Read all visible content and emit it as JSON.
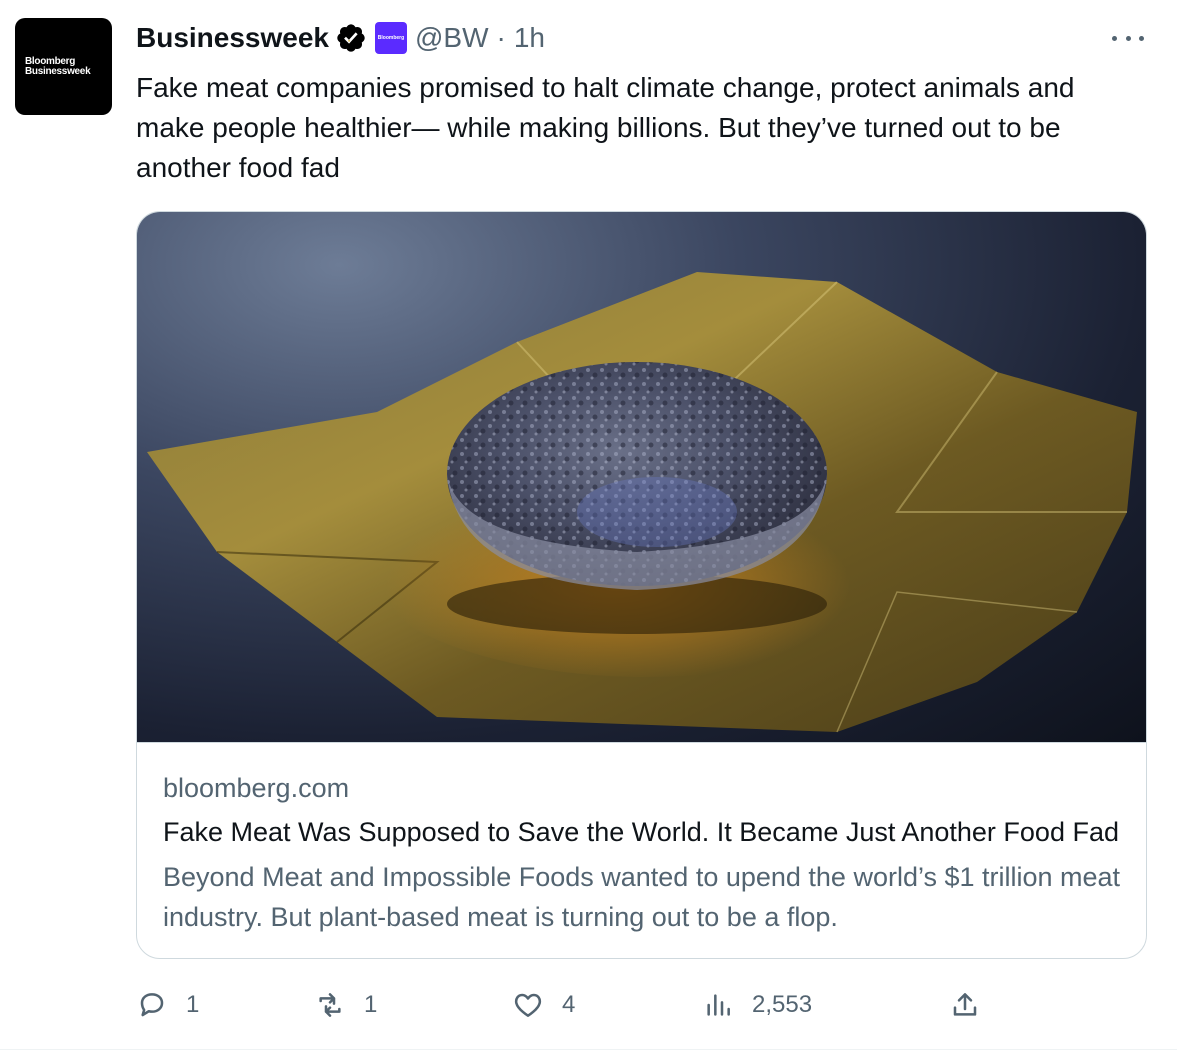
{
  "account": {
    "avatar_line1": "Bloomberg",
    "avatar_line2": "Businessweek",
    "display_name": "Businessweek",
    "affiliate_badge_text": "Bloomberg",
    "handle": "@BW",
    "separator": "·",
    "time": "1h"
  },
  "tweet": {
    "text": "Fake meat companies promised to halt climate change, protect animals and make people healthier— while making billions. But they’ve turned out to be another food fad"
  },
  "card": {
    "domain": "bloomberg.com",
    "title": "Fake Meat Was Supposed to Save the World. It Became Just Another Food Fad",
    "description": "Beyond Meat and Impossible Foods wanted to upend the world’s $1 trillion meat industry. But plant-based meat is turning out to be a flop."
  },
  "actions": {
    "replies": "1",
    "retweets": "1",
    "likes": "4",
    "views": "2,553"
  },
  "colors": {
    "text_primary": "#0f1419",
    "text_secondary": "#536471",
    "border": "#cfd9de",
    "verified_badge": "#000000",
    "affiliate_badge": "#5b2bff"
  },
  "icons": {
    "verified": "verified-badge-icon",
    "more": "more-dots-icon",
    "reply": "reply-bubble-icon",
    "retweet": "retweet-arrows-icon",
    "like": "heart-icon",
    "views": "bar-chart-icon",
    "share": "share-upload-icon"
  }
}
